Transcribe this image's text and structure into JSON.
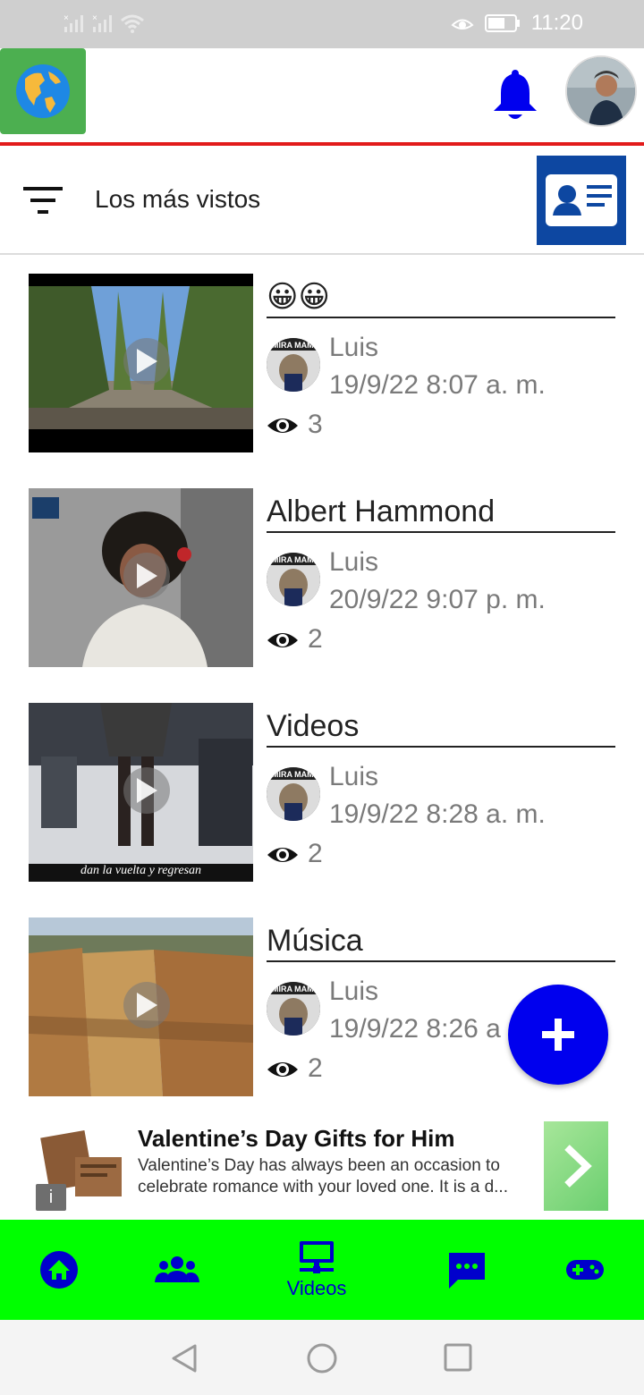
{
  "status_bar": {
    "time": "11:20",
    "icons": [
      "signal-off-icon",
      "signal-off-icon",
      "wifi-icon",
      "eye-comfort-icon",
      "battery-icon"
    ]
  },
  "app_bar": {
    "logo_icon": "globe-icon",
    "notification_icon": "bell-icon",
    "profile_avatar": "user-avatar"
  },
  "filter": {
    "label": "Los más vistos",
    "icon": "filter-icon",
    "contact_card_icon": "id-card-icon"
  },
  "feed": [
    {
      "title": "😀😀",
      "author": "Luis",
      "date": "19/9/22 8:07 a. m.",
      "views": "3",
      "thumb": "tree-lined-road",
      "caption": ""
    },
    {
      "title": "Albert Hammond",
      "author": "Luis",
      "date": "20/9/22 9:07 p. m.",
      "views": "2",
      "thumb": "singer-microphone",
      "caption": ""
    },
    {
      "title": "Videos",
      "author": "Luis",
      "date": "19/9/22 8:28 a. m.",
      "views": "2",
      "thumb": "legs-walking",
      "caption": "dan la vuelta y regresan"
    },
    {
      "title": "Música",
      "author": "Luis",
      "date": "19/9/22 8:26 a",
      "views": "2",
      "thumb": "rock-canyon",
      "caption": ""
    }
  ],
  "fab": {
    "icon": "plus-icon"
  },
  "ad": {
    "title": "Valentine’s Day Gifts for Him",
    "desc_line1": "Valentine’s Day has always been an occasion to",
    "desc_line2": "celebrate romance with your loved one. It is a d...",
    "info_label": "i"
  },
  "bottom_nav": {
    "items": [
      {
        "icon": "home-icon",
        "label": ""
      },
      {
        "icon": "group-icon",
        "label": ""
      },
      {
        "icon": "videos-icon",
        "label": "Videos"
      },
      {
        "icon": "chat-icon",
        "label": ""
      },
      {
        "icon": "gamepad-icon",
        "label": ""
      }
    ],
    "active_index": 2
  },
  "colors": {
    "status_bar": "#cfcfcf",
    "accent_red": "#e21b1b",
    "logo_green": "#4caf50",
    "id_card_blue": "#0d47a1",
    "nav_green": "#00ff00",
    "nav_icon_blue": "#0000cc",
    "fab_blue": "#0000ee"
  }
}
